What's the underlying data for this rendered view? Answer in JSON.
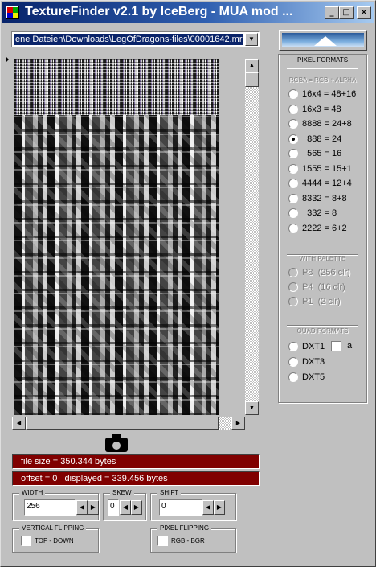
{
  "window": {
    "title": "TextureFinder v2.1 by IceBerg - MUA mod ...",
    "buttons": {
      "minimize": "_",
      "maximize": "□",
      "close": "×"
    }
  },
  "file_path": "ene Dateien\\Downloads\\LegOfDragons-files\\00001642.mrg",
  "info": {
    "file_size": "file size = 350.344 bytes",
    "offset": "offset = 0   displayed = 339.456 bytes"
  },
  "width": {
    "label": "WIDTH",
    "value": "256"
  },
  "skew": {
    "label": "SKEW",
    "value": "0"
  },
  "shift": {
    "label": "SHIFT",
    "value": "0"
  },
  "vertical_flipping": {
    "label": "VERTICAL FLIPPING",
    "option": "TOP - DOWN"
  },
  "pixel_flipping": {
    "label": "PIXEL FLIPPING",
    "option": "RGB  -  BGR"
  },
  "pixel_formats": {
    "title": "PIXEL FORMATS",
    "subtitle": "RGBA = RGB + ALPHA",
    "options": [
      {
        "label": "16x4 = 48+16",
        "selected": false
      },
      {
        "label": "16x3 = 48",
        "selected": false
      },
      {
        "label": "8888 = 24+8",
        "selected": false
      },
      {
        "label": "  888 = 24",
        "selected": true
      },
      {
        "label": "  565 = 16",
        "selected": false
      },
      {
        "label": "1555 = 15+1",
        "selected": false
      },
      {
        "label": "4444 = 12+4",
        "selected": false
      },
      {
        "label": "8332 = 8+8",
        "selected": false
      },
      {
        "label": "  332 = 8",
        "selected": false
      },
      {
        "label": "2222 = 6+2",
        "selected": false
      }
    ]
  },
  "palette": {
    "title": "WITH PALETTE",
    "options": [
      "P8  (256 clr)",
      "P4  (16 clr)",
      "P1  (2 clr)"
    ]
  },
  "quad": {
    "title": "QUAD FORMATS",
    "options": [
      "DXT1",
      "DXT3",
      "DXT5"
    ],
    "alpha_label": "a"
  },
  "colors": {
    "title_start": "#08246b",
    "title_end": "#a6caf0",
    "info_bg": "#800000",
    "selection": "#0a246a"
  },
  "icons": {
    "snapshot": "camera-icon",
    "app": "app-icon"
  }
}
